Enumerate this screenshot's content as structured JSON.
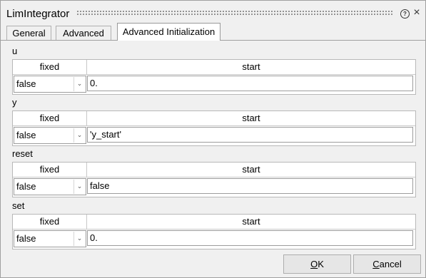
{
  "window": {
    "title": "LimIntegrator"
  },
  "tabs": [
    {
      "label": "General"
    },
    {
      "label": "Advanced"
    },
    {
      "label": "Advanced Initialization"
    }
  ],
  "columns": {
    "fixed": "fixed",
    "start": "start"
  },
  "sections": [
    {
      "label": "u",
      "fixed": "false",
      "start": "0."
    },
    {
      "label": "y",
      "fixed": "false",
      "start": "'y_start'"
    },
    {
      "label": "reset",
      "fixed": "false",
      "start": "false"
    },
    {
      "label": "set",
      "fixed": "false",
      "start": "0."
    }
  ],
  "buttons": {
    "ok": {
      "mnemonic": "O",
      "rest": "K"
    },
    "cancel": {
      "mnemonic": "C",
      "rest": "ancel"
    }
  }
}
